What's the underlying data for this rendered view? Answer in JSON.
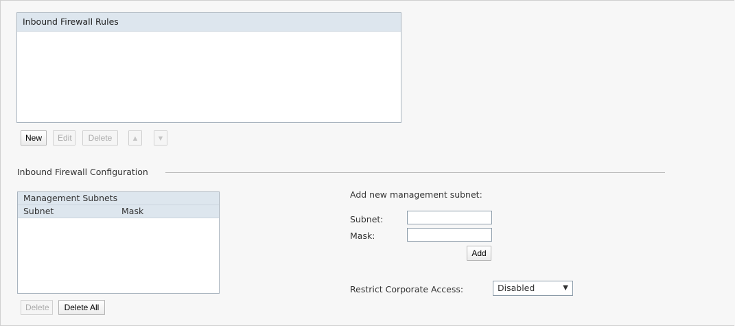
{
  "rules": {
    "title": "Inbound Firewall Rules",
    "buttons": {
      "new": "New",
      "edit": "Edit",
      "delete": "Delete",
      "move_up_icon": "arrow-up-icon",
      "move_down_icon": "arrow-down-icon"
    }
  },
  "config": {
    "legend": "Inbound Firewall Configuration",
    "subnets_list": {
      "title": "Management Subnets",
      "columns": [
        "Subnet",
        "Mask"
      ],
      "rows": []
    },
    "subnet_buttons": {
      "delete": "Delete",
      "delete_all": "Delete All"
    },
    "add_form": {
      "heading": "Add new management subnet:",
      "subnet_label": "Subnet:",
      "subnet_value": "",
      "mask_label": "Mask:",
      "mask_value": "",
      "add_button": "Add"
    },
    "restrict": {
      "label": "Restrict Corporate Access:",
      "selected": "Disabled"
    }
  },
  "colors": {
    "header_bg": "#dde6ee",
    "page_bg": "#f7f7f7",
    "border": "#a9b4bf"
  }
}
